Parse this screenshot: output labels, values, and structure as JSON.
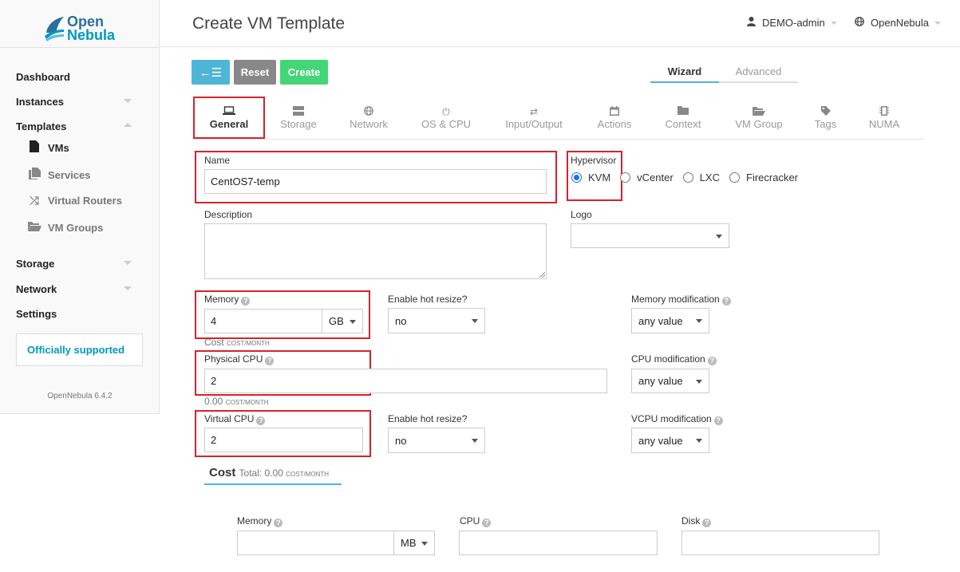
{
  "brand": {
    "line1": "Open",
    "line2": "Nebula"
  },
  "sidebar": {
    "dashboard": "Dashboard",
    "instances": "Instances",
    "templates": "Templates",
    "sub": {
      "vms": "VMs",
      "services": "Services",
      "routers": "Virtual Routers",
      "groups": "VM Groups"
    },
    "storage": "Storage",
    "network": "Network",
    "settings": "Settings",
    "supported": "Officially supported",
    "version": "OpenNebula 6.4.2"
  },
  "header": {
    "title": "Create VM Template",
    "user": "DEMO-admin",
    "zone": "OpenNebula"
  },
  "toolbar": {
    "back_icon": "←☰",
    "reset": "Reset",
    "create": "Create"
  },
  "modes": {
    "wizard": "Wizard",
    "advanced": "Advanced"
  },
  "tabs": [
    {
      "label": "General",
      "icon": "laptop-icon"
    },
    {
      "label": "Storage",
      "icon": "server-icon"
    },
    {
      "label": "Network",
      "icon": "globe-icon"
    },
    {
      "label": "OS & CPU",
      "icon": "power-icon"
    },
    {
      "label": "Input/Output",
      "icon": "exchange-icon"
    },
    {
      "label": "Actions",
      "icon": "calendar-icon"
    },
    {
      "label": "Context",
      "icon": "folder-icon"
    },
    {
      "label": "VM Group",
      "icon": "folder-open-icon"
    },
    {
      "label": "Tags",
      "icon": "tag-icon"
    },
    {
      "label": "NUMA",
      "icon": "chip-icon"
    }
  ],
  "form": {
    "name_label": "Name",
    "name_value": "CentOS7-temp",
    "hypervisor_label": "Hypervisor",
    "hypervisors": [
      "KVM",
      "vCenter",
      "LXC",
      "Firecracker"
    ],
    "description_label": "Description",
    "logo_label": "Logo",
    "memory_label": "Memory",
    "memory_value": "4",
    "memory_unit": "GB",
    "hot_resize_label": "Enable hot resize?",
    "hot_resize_value": "no",
    "memory_mod_label": "Memory modification",
    "memory_mod_value": "any value",
    "memory_cost": "Cost",
    "cost_unit": "COST/MONTH",
    "pcpu_label": "Physical CPU",
    "pcpu_value": "2",
    "pcpu_cost": "0.00",
    "cpu_mod_label": "CPU modification",
    "cpu_mod_value": "any value",
    "vcpu_label": "Virtual CPU",
    "vcpu_value": "2",
    "vcpu_hot_label": "Enable hot resize?",
    "vcpu_hot_value": "no",
    "vcpu_mod_label": "VCPU modification",
    "vcpu_mod_value": "any value"
  },
  "cost": {
    "title": "Cost",
    "total_label": "Total: 0.00",
    "memory_label": "Memory",
    "memory_unit": "MB",
    "cpu_label": "CPU",
    "disk_label": "Disk"
  },
  "colors": {
    "accent": "#4fb5d6",
    "create": "#43d679",
    "reset": "#888888",
    "highlight": "#d6232b"
  }
}
